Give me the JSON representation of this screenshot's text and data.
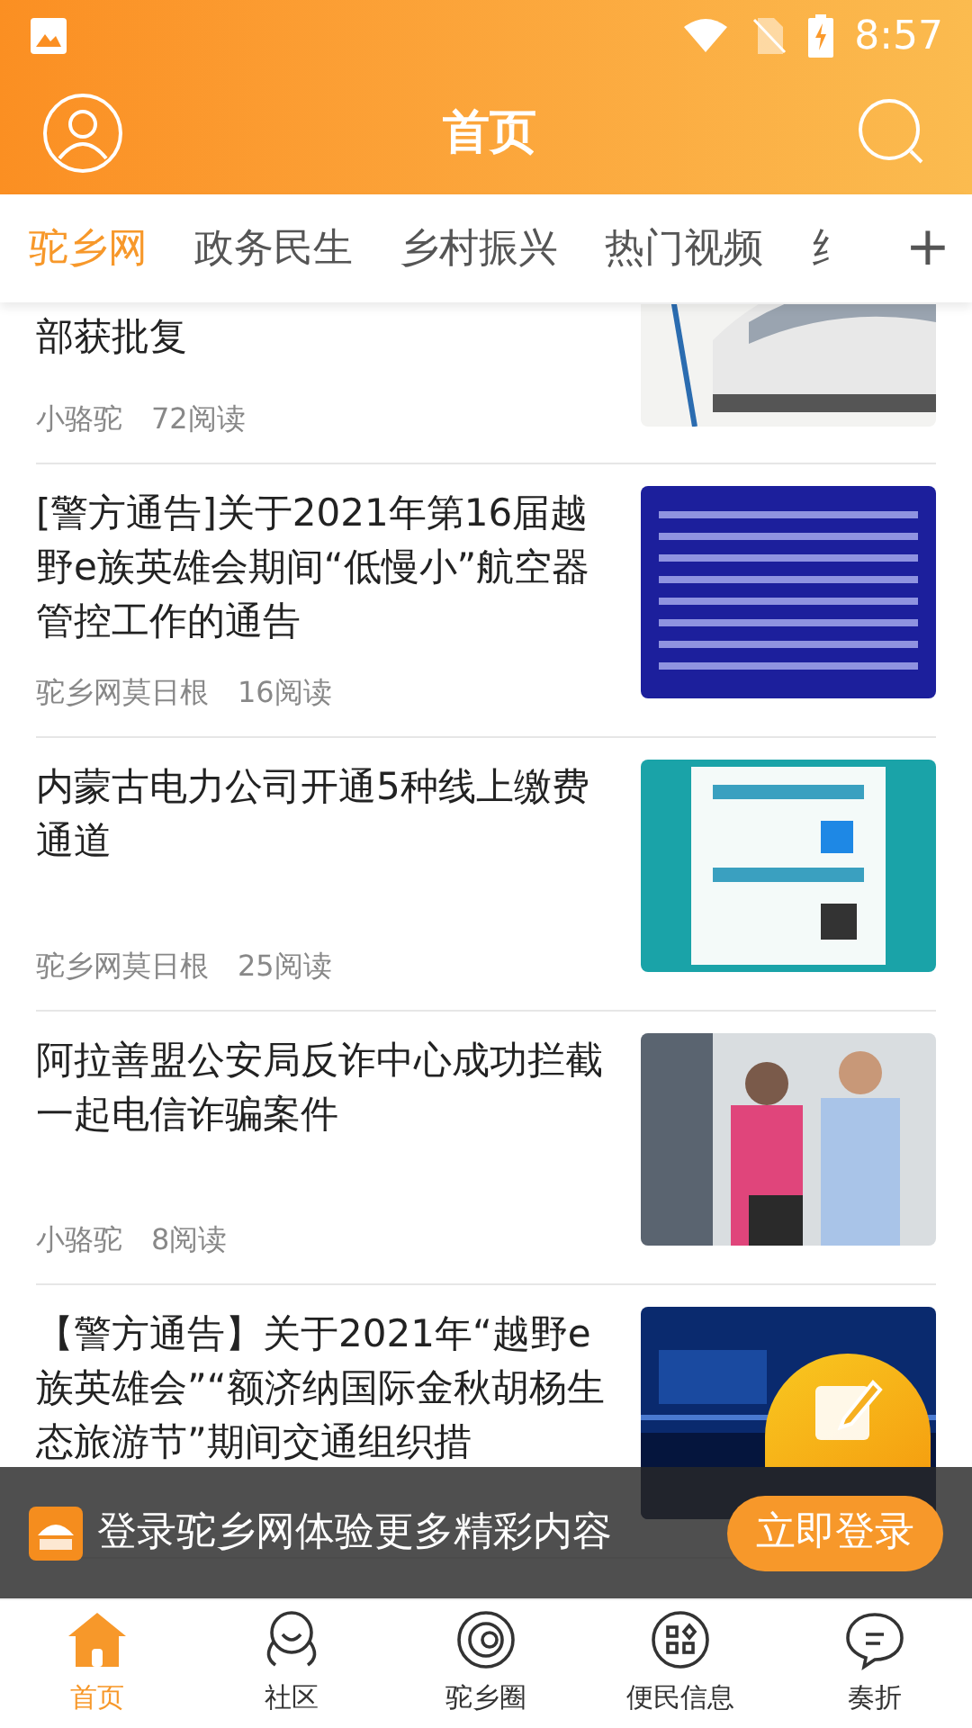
{
  "status_bar": {
    "time": "8:57"
  },
  "header": {
    "title": "首页"
  },
  "tabs": [
    {
      "label": "驼乡网",
      "selected": true
    },
    {
      "label": "政务民生",
      "selected": false
    },
    {
      "label": "乡村振兴",
      "selected": false
    },
    {
      "label": "热门视频",
      "selected": false
    },
    {
      "label": "纟",
      "selected": false
    }
  ],
  "tabs_add": "+",
  "articles": [
    {
      "title": "部获批复",
      "author": "小骆驼",
      "reads": "72阅读"
    },
    {
      "title": "[警方通告]关于2021年第16届越野e族英雄会期间“低慢小”航空器管控工作的通告",
      "author": "驼乡网莫日根",
      "reads": "16阅读"
    },
    {
      "title": "内蒙古电力公司开通5种线上缴费通道",
      "author": "驼乡网莫日根",
      "reads": "25阅读"
    },
    {
      "title": "阿拉善盟公安局反诈中心成功拦截一起电信诈骗案件",
      "author": "小骆驼",
      "reads": "8阅读"
    },
    {
      "title": "【警方通告】关于2021年“越野e族英雄会”“额济纳国际金秋胡杨生态旅游节”期间交通组织措"
    }
  ],
  "login_banner": {
    "text": "登录驼乡网体验更多精彩内容",
    "button": "立即登录"
  },
  "bottom_nav": [
    {
      "label": "首页",
      "selected": true
    },
    {
      "label": "社区",
      "selected": false
    },
    {
      "label": "驼乡圈",
      "selected": false
    },
    {
      "label": "便民信息",
      "selected": false
    },
    {
      "label": "奏折",
      "selected": false
    }
  ]
}
